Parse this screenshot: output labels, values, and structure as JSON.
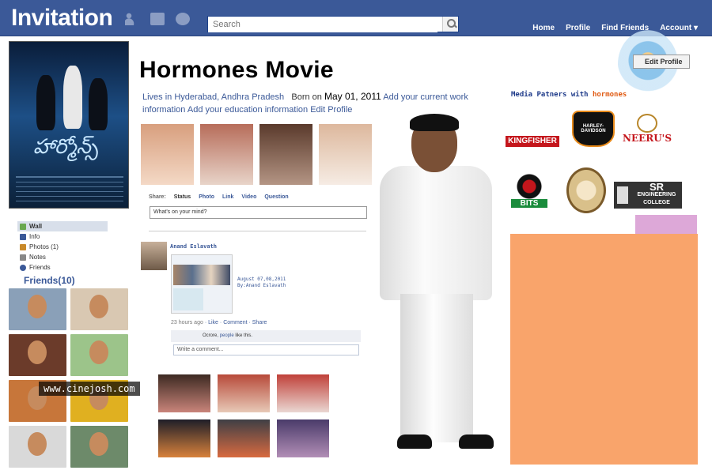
{
  "header": {
    "brand": "Invitation",
    "search_placeholder": "Search",
    "nav": [
      "Home",
      "Profile",
      "Find Friends",
      "Account"
    ]
  },
  "profile": {
    "name": "Hormones Movie",
    "lives_in": "Lives in Hyderabad, Andhra Pradesh",
    "born_on_label": "Born on",
    "born_on_date": "May 01, 2011",
    "add_work": "Add your current work",
    "info_label": "information",
    "add_education": "Add your education information",
    "edit_profile_inline": "Edit Profile",
    "edit_profile_button": "Edit Profile"
  },
  "poster": {
    "title_telugu": "హార్మోన్స్"
  },
  "sidebar": {
    "items": [
      {
        "label": "Wall",
        "icon": "wall-icon",
        "color": "#6aa84f"
      },
      {
        "label": "Info",
        "icon": "info-icon",
        "color": "#3b5998"
      },
      {
        "label": "Photos (1)",
        "icon": "photos-icon",
        "color": "#c98a2a"
      },
      {
        "label": "Notes",
        "icon": "notes-icon",
        "color": "#888888"
      },
      {
        "label": "Friends",
        "icon": "friends-icon",
        "color": "#3b5998"
      }
    ],
    "friends_title": "Friends(10)"
  },
  "watermark": "www.cinejosh.com",
  "composer": {
    "share_label": "Share:",
    "options": [
      "Status",
      "Photo",
      "Link",
      "Video",
      "Question"
    ],
    "placeholder": "What's on your mind?"
  },
  "post": {
    "author": "Anand Eslavath",
    "meta_line1": "August 07,08,2011",
    "meta_line2": "By:Anand Eslavath",
    "time": "23 hours ago",
    "like": "Like",
    "comment": "Comment",
    "share": "Share",
    "likes_prefix": "Ocrore,",
    "likes_people": "people",
    "likes_suffix": "like this.",
    "comment_placeholder": "Write a comment..."
  },
  "partners": {
    "title_prefix": "Media Patners with",
    "title_highlight": "hormones",
    "kingfisher": "KINGFISHER",
    "harley": "HARLEY-DAVIDSON",
    "neerus": "NEERU'S",
    "bits": "BITS",
    "sr_line1": "SR",
    "sr_line2": "ENGINEERING COLLEGE"
  },
  "colors": {
    "header_blue": "#3b5998",
    "orange_panel": "#f9a46b",
    "pink_panel": "#dda8d8"
  }
}
